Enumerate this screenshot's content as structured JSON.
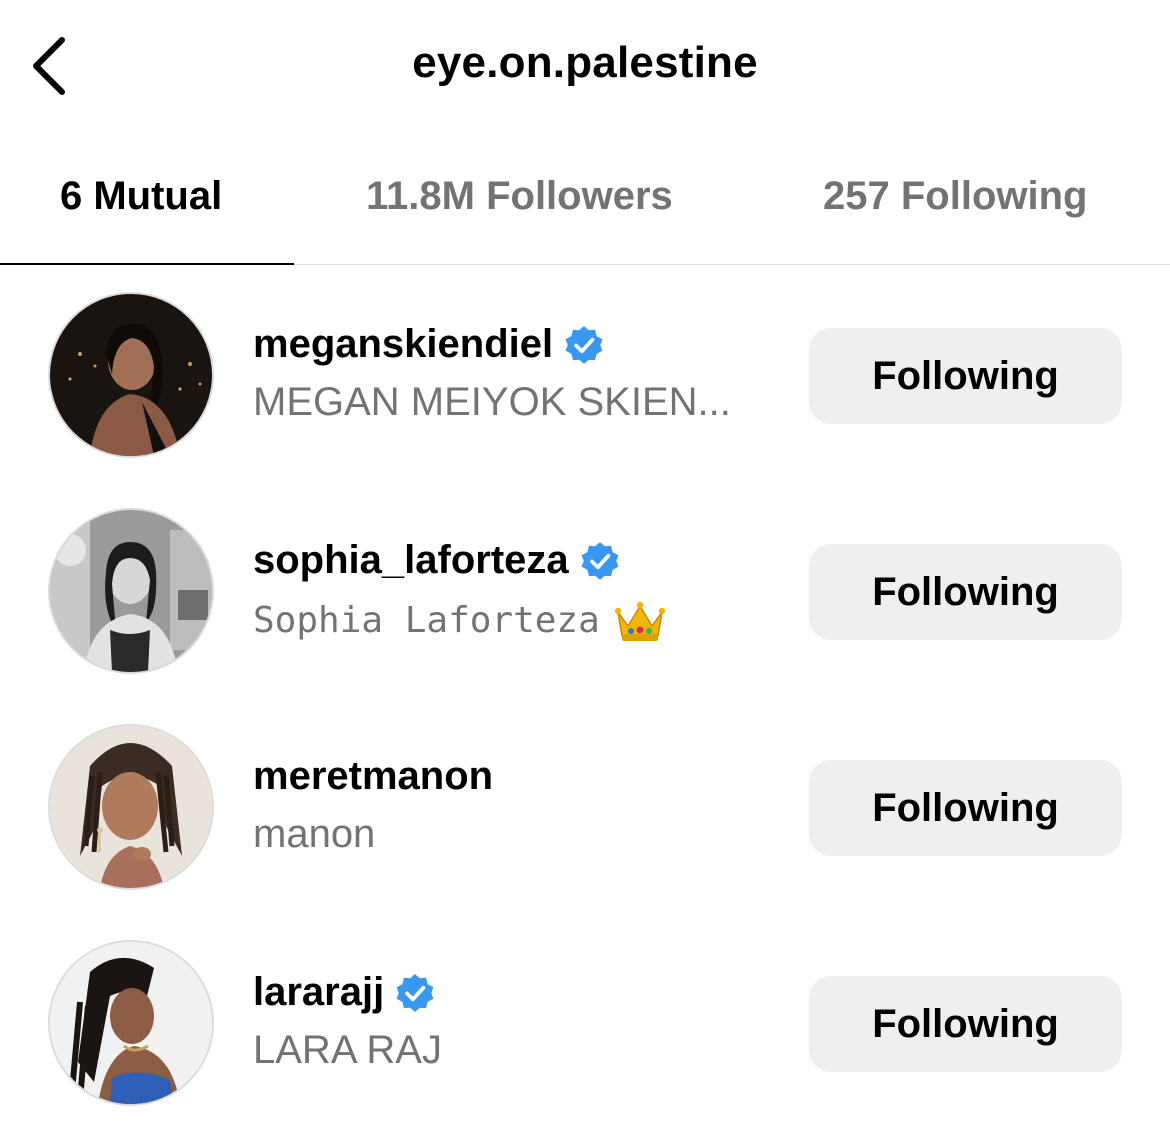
{
  "header": {
    "title": "eye.on.palestine",
    "back_icon": "chevron-left-icon"
  },
  "tabs": [
    {
      "label": "6 Mutual",
      "active": true
    },
    {
      "label": "11.8M Followers",
      "active": false
    },
    {
      "label": "257 Following",
      "active": false
    }
  ],
  "accounts": [
    {
      "username": "meganskiendiel",
      "name": "MEGAN MEIYOK SKIEN...",
      "verified": true,
      "button": "Following"
    },
    {
      "username": "sophia_laforteza",
      "name": "Sophia Laforteza",
      "name_emoji": "crown-icon",
      "verified": true,
      "button": "Following"
    },
    {
      "username": "meretmanon",
      "name": "manon",
      "verified": false,
      "button": "Following"
    },
    {
      "username": "lararajj",
      "name": "LARA RAJ",
      "verified": true,
      "button": "Following"
    }
  ],
  "colors": {
    "verified_blue": "#3897f0",
    "secondary_text": "#737373",
    "button_bg": "#efefef",
    "divider": "#dbdbdb"
  }
}
